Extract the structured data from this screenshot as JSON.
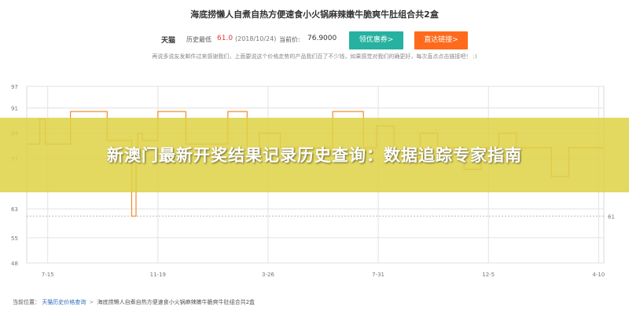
{
  "product": {
    "title": "海底捞懒人自煮自热方便速食小火锅麻辣嫩牛脆爽牛肚组合共2盒"
  },
  "info": {
    "store": "天猫",
    "historical_low_label": "历史最低",
    "historical_low_value": "61.0",
    "historical_low_date": "(2018/10/24)",
    "current_price_label": "当前价:",
    "current_price_value": "76.9000",
    "coupon_button": "领优惠券>",
    "buy_button": "直达链接>"
  },
  "notice": "再说多说友发邮件过来感谢我们，上面要说这个价格走势的产品我们百了不少钱，如果感觉对我们的确更好，每次直点点击链接吧！ :)",
  "banner": {
    "headline": "新澳门最新开奖结果记录历史查询：数据追踪专家指南"
  },
  "breadcrumb": {
    "prefix": "当前位置：",
    "link": "天猫历史价格查询",
    "separator": ">",
    "current": "海底捞懒人自煮自热方便速食小火锅麻辣嫩牛脆爽牛肚组合共2盒"
  },
  "colors": {
    "line": "#f08c2a",
    "grid": "#e2e2e2",
    "dashed_low": "#bbbbbb",
    "coupon_bg": "#27b1a0",
    "buy_bg": "#ff6a1c",
    "banner_bg": "#ded246"
  },
  "chart_data": {
    "type": "line",
    "title": "",
    "xlabel": "",
    "ylabel": "",
    "y_ticks": [
      "97",
      "91",
      "84",
      "77",
      "63",
      "55",
      "48"
    ],
    "y_tick_values": [
      97,
      91,
      84,
      77,
      63,
      55,
      48
    ],
    "ylim": [
      48,
      97
    ],
    "x_ticks": [
      "7-15",
      "11-19",
      "3-26",
      "7-31",
      "12-5",
      "4-10"
    ],
    "x_tick_positions": [
      24,
      150,
      276,
      402,
      528,
      654
    ],
    "xlim": [
      0,
      660
    ],
    "low_line_value": 61,
    "low_line_label": "61",
    "grid": true,
    "series": [
      {
        "values_x": [
          0,
          15,
          15,
          21,
          21,
          50,
          50,
          92,
          92,
          120,
          120,
          125,
          125,
          127,
          127,
          132,
          132,
          150,
          150,
          182,
          182,
          230,
          230,
          252,
          252,
          266,
          266,
          290,
          290,
          350,
          350,
          385,
          385,
          400,
          400,
          420,
          420,
          450,
          450,
          470,
          470,
          500,
          500,
          520,
          520,
          540,
          540,
          560,
          560,
          600,
          600,
          620,
          620,
          660
        ],
        "values_y": [
          81,
          81,
          88,
          88,
          81,
          81,
          90,
          90,
          82,
          82,
          61,
          61,
          77,
          77,
          84,
          84,
          82,
          82,
          90,
          90,
          81,
          81,
          90,
          90,
          80,
          80,
          84,
          84,
          80,
          80,
          90,
          90,
          80,
          80,
          86,
          86,
          77,
          77,
          84,
          84,
          80,
          80,
          74,
          74,
          80,
          80,
          84,
          84,
          80,
          80,
          72,
          72,
          80,
          80
        ]
      }
    ]
  }
}
